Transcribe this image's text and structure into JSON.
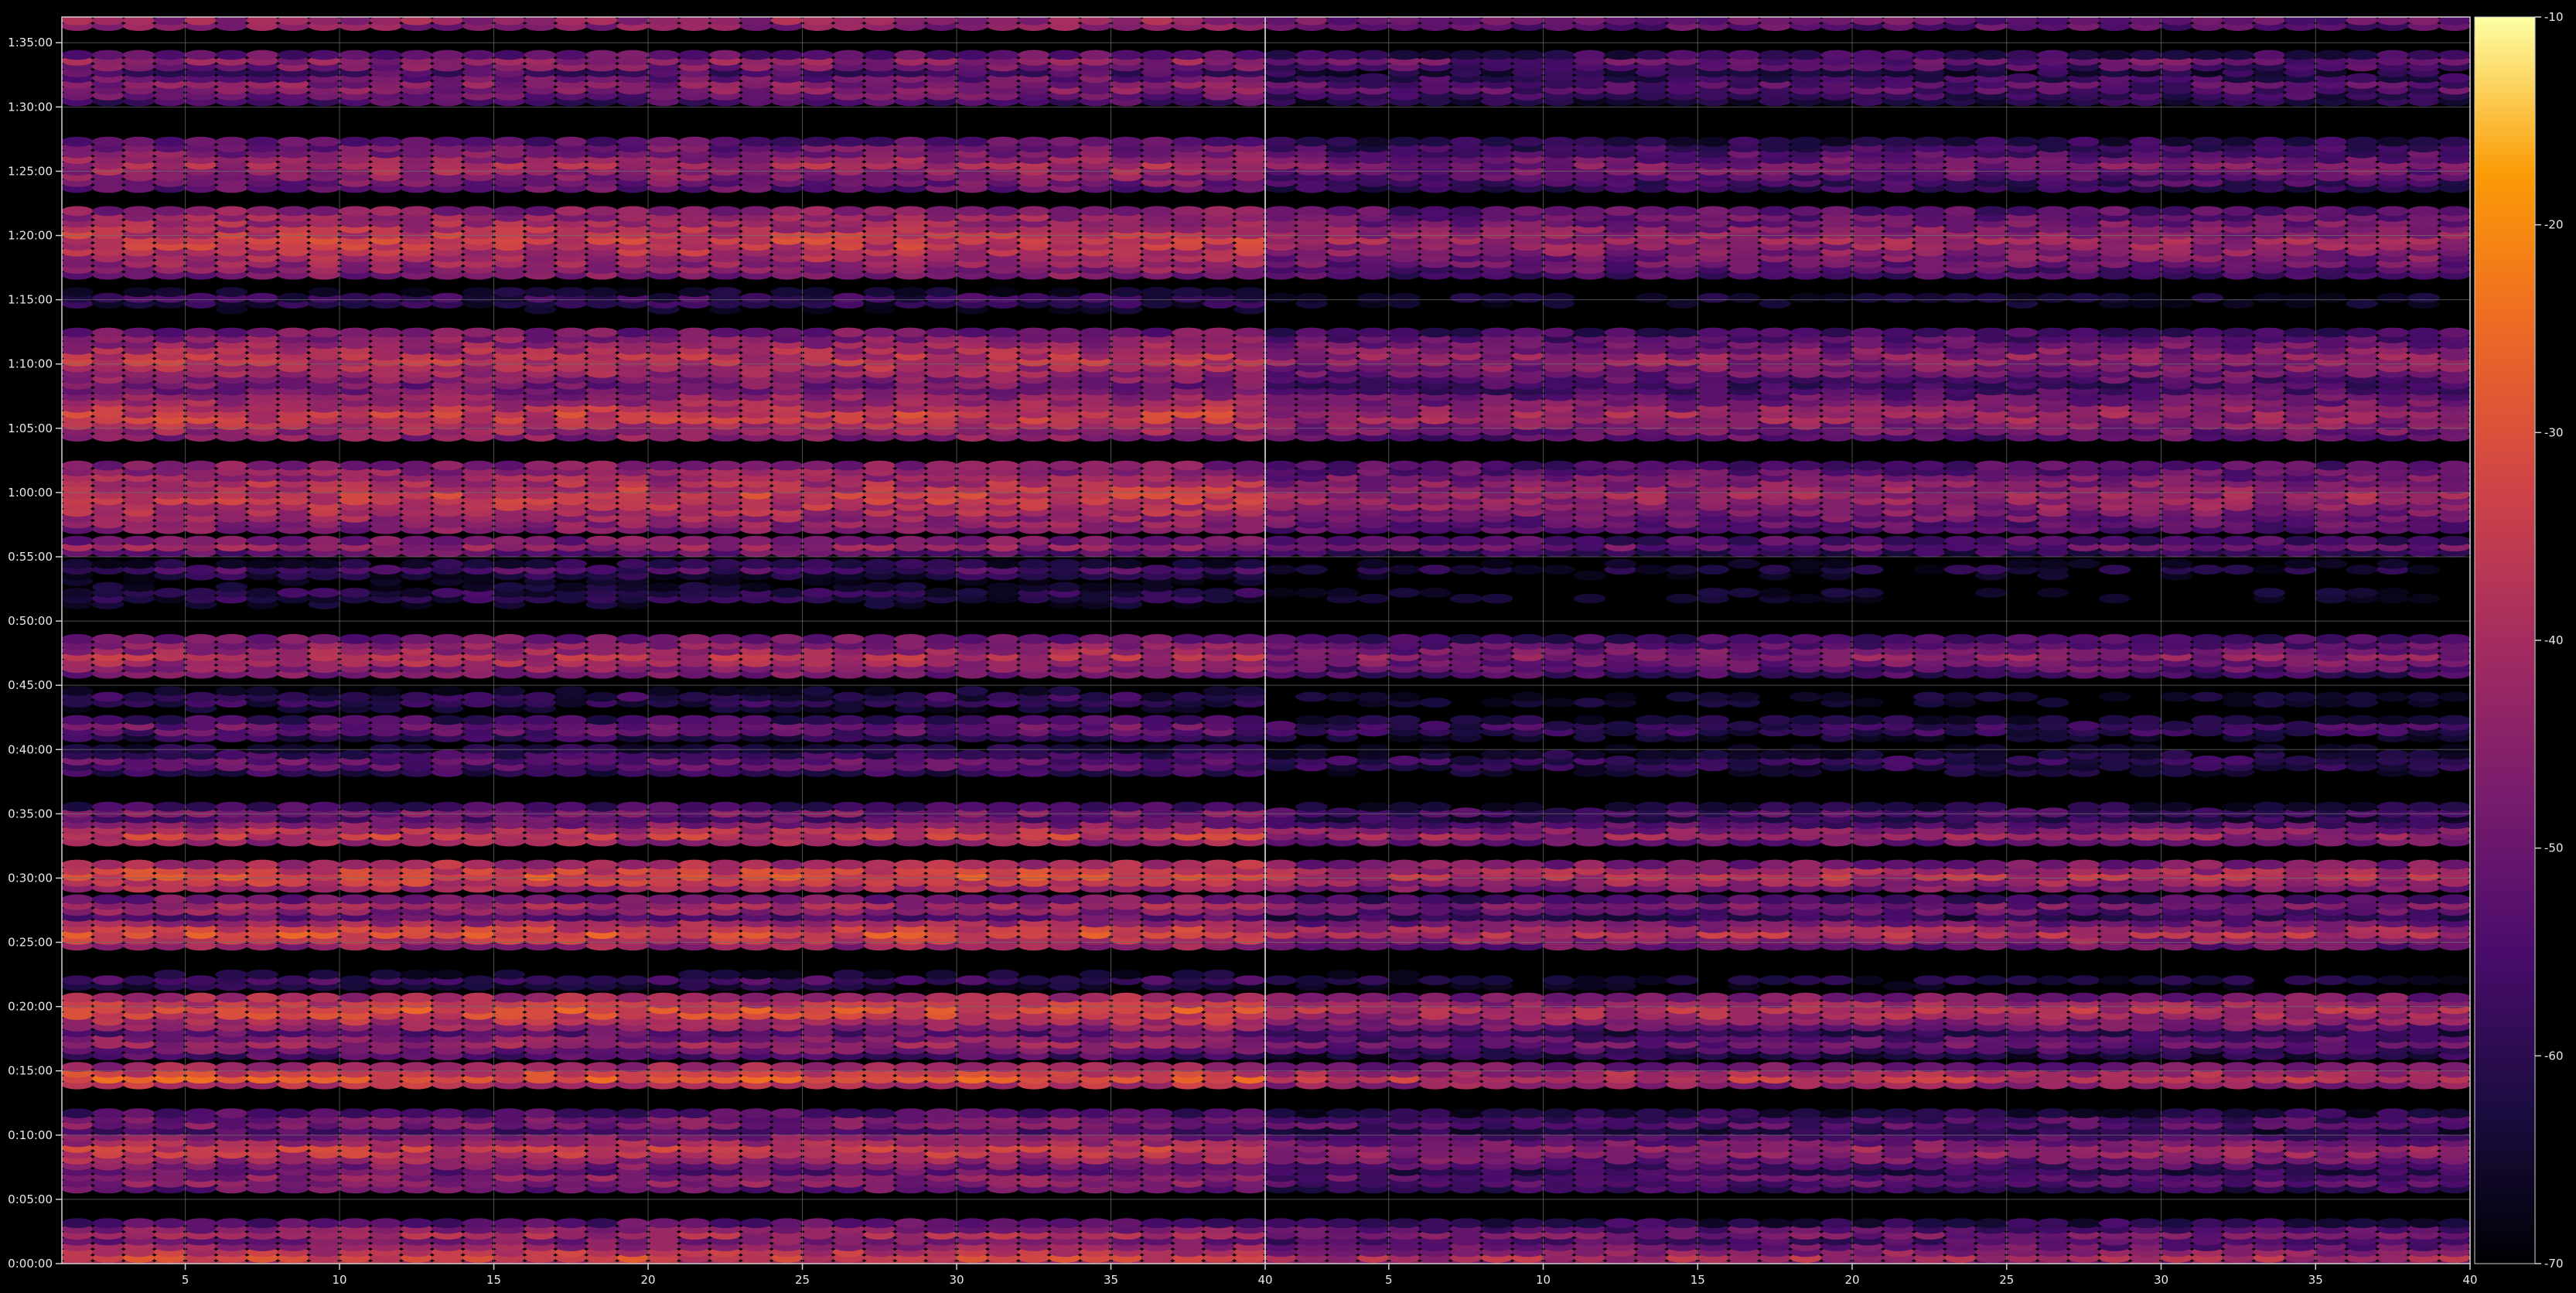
{
  "chart_data": {
    "type": "heatmap",
    "title": "",
    "xlabel": "",
    "ylabel": "",
    "background": "#000000",
    "grid": true,
    "grid_color": "#707070",
    "colormap": "inferno",
    "panels": [
      {
        "name": "left",
        "x_ticks": [
          5,
          10,
          15,
          20,
          25,
          30,
          35,
          40
        ],
        "x_range": [
          1,
          40
        ],
        "columns": 39,
        "level_scale": 1.0
      },
      {
        "name": "right",
        "x_ticks": [
          5,
          10,
          15,
          20,
          25,
          30,
          35,
          40
        ],
        "x_range": [
          1,
          40
        ],
        "columns": 39,
        "level_scale": 0.82
      }
    ],
    "y_axis": {
      "range_minutes": [
        0,
        97
      ],
      "ticks": [
        {
          "minutes": 0,
          "label": "0:00:00"
        },
        {
          "minutes": 5,
          "label": "0:05:00"
        },
        {
          "minutes": 10,
          "label": "0:10:00"
        },
        {
          "minutes": 15,
          "label": "0:15:00"
        },
        {
          "minutes": 20,
          "label": "0:20:00"
        },
        {
          "minutes": 25,
          "label": "0:25:00"
        },
        {
          "minutes": 30,
          "label": "0:30:00"
        },
        {
          "minutes": 35,
          "label": "0:35:00"
        },
        {
          "minutes": 40,
          "label": "0:40:00"
        },
        {
          "minutes": 45,
          "label": "0:45:00"
        },
        {
          "minutes": 50,
          "label": "0:50:00"
        },
        {
          "minutes": 55,
          "label": "0:55:00"
        },
        {
          "minutes": 60,
          "label": "1:00:00"
        },
        {
          "minutes": 65,
          "label": "1:05:00"
        },
        {
          "minutes": 70,
          "label": "1:10:00"
        },
        {
          "minutes": 75,
          "label": "1:15:00"
        },
        {
          "minutes": 80,
          "label": "1:20:00"
        },
        {
          "minutes": 85,
          "label": "1:25:00"
        },
        {
          "minutes": 90,
          "label": "1:30:00"
        },
        {
          "minutes": 95,
          "label": "1:35:00"
        }
      ]
    },
    "colorbar": {
      "range": [
        -70,
        -10
      ],
      "ticks": [
        {
          "value": -10,
          "label": "-10"
        },
        {
          "value": -20,
          "label": "-20"
        },
        {
          "value": -30,
          "label": "-30"
        },
        {
          "value": -40,
          "label": "-40"
        },
        {
          "value": -50,
          "label": "-50"
        },
        {
          "value": -60,
          "label": "-60"
        },
        {
          "value": -70,
          "label": "-70"
        }
      ]
    },
    "bands": [
      {
        "center_min": 0.5,
        "width_min": 1.6,
        "level_dB": -32
      },
      {
        "center_min": 2.3,
        "width_min": 1.4,
        "level_dB": -40
      },
      {
        "center_min": 6.5,
        "width_min": 1.6,
        "level_dB": -42
      },
      {
        "center_min": 8.8,
        "width_min": 2.0,
        "level_dB": -34
      },
      {
        "center_min": 11.0,
        "width_min": 1.4,
        "level_dB": -44
      },
      {
        "center_min": 14.5,
        "width_min": 1.2,
        "level_dB": -28
      },
      {
        "center_min": 17.2,
        "width_min": 1.8,
        "level_dB": -42
      },
      {
        "center_min": 19.7,
        "width_min": 2.2,
        "level_dB": -30
      },
      {
        "center_min": 22.0,
        "width_min": 1.0,
        "level_dB": -56
      },
      {
        "center_min": 25.7,
        "width_min": 1.6,
        "level_dB": -30
      },
      {
        "center_min": 27.8,
        "width_min": 1.4,
        "level_dB": -40
      },
      {
        "center_min": 30.2,
        "width_min": 2.0,
        "level_dB": -30
      },
      {
        "center_min": 33.4,
        "width_min": 1.4,
        "level_dB": -34
      },
      {
        "center_min": 35.0,
        "width_min": 1.0,
        "level_dB": -46
      },
      {
        "center_min": 39.0,
        "width_min": 1.8,
        "level_dB": -50
      },
      {
        "center_min": 41.7,
        "width_min": 1.4,
        "level_dB": -48
      },
      {
        "center_min": 43.9,
        "width_min": 1.2,
        "level_dB": -56
      },
      {
        "center_min": 47.2,
        "width_min": 3.0,
        "level_dB": -38
      },
      {
        "center_min": 52.0,
        "width_min": 1.6,
        "level_dB": -58
      },
      {
        "center_min": 54.0,
        "width_min": 1.4,
        "level_dB": -56
      },
      {
        "center_min": 55.9,
        "width_min": 1.2,
        "level_dB": -42
      },
      {
        "center_min": 59.7,
        "width_min": 5.0,
        "level_dB": -34
      },
      {
        "center_min": 66.0,
        "width_min": 3.6,
        "level_dB": -34
      },
      {
        "center_min": 70.4,
        "width_min": 4.0,
        "level_dB": -36
      },
      {
        "center_min": 75.0,
        "width_min": 1.2,
        "level_dB": -56
      },
      {
        "center_min": 79.6,
        "width_min": 5.0,
        "level_dB": -34
      },
      {
        "center_min": 85.4,
        "width_min": 3.6,
        "level_dB": -40
      },
      {
        "center_min": 91.6,
        "width_min": 2.4,
        "level_dB": -44
      },
      {
        "center_min": 93.5,
        "width_min": 1.2,
        "level_dB": -42
      },
      {
        "center_min": 96.6,
        "width_min": 1.0,
        "level_dB": -40
      }
    ]
  }
}
